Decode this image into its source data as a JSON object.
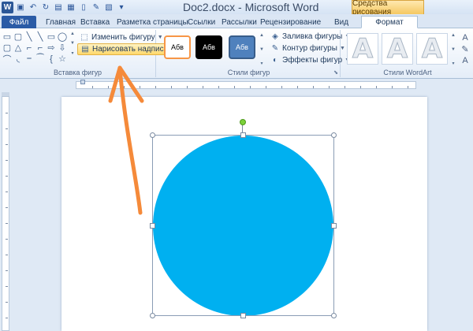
{
  "window": {
    "title": "Doc2.docx - Microsoft Word",
    "context_tab_group": "Средства рисования",
    "word_logo": "W"
  },
  "quick_access": [
    "save-icon",
    "undo-icon",
    "redo-icon",
    "open-icon",
    "print-icon",
    "new-icon",
    "format-painter-icon",
    "image-icon",
    "customize-icon"
  ],
  "tabs": [
    {
      "label": "Файл",
      "type": "file"
    },
    {
      "label": "Главная"
    },
    {
      "label": "Вставка"
    },
    {
      "label": "Разметка страницы"
    },
    {
      "label": "Ссылки"
    },
    {
      "label": "Рассылки"
    },
    {
      "label": "Рецензирование"
    },
    {
      "label": "Вид"
    },
    {
      "label": "Формат",
      "active": true
    }
  ],
  "ribbon": {
    "insert_shapes": {
      "label": "Вставка фигур",
      "edit_shape": "Изменить фигуру",
      "draw_textbox": "Нарисовать надпись",
      "shape_glyphs": [
        "▭",
        "▢",
        "╲",
        "╲",
        "▭",
        "◯",
        "▢",
        "△",
        "⌐",
        "⌐",
        "⇨",
        "⇩",
        "⌒",
        "◟",
        "⎯",
        "⁀",
        "{",
        "☆"
      ]
    },
    "shape_styles": {
      "label": "Стили фигур",
      "thumb_text": "Абв",
      "fill": "Заливка фигуры",
      "outline": "Контур фигуры",
      "effects": "Эффекты фигур",
      "thumb_colors": [
        "#ffffff",
        "#000000",
        "#4f81bd"
      ],
      "thumb_border_colors": [
        "#f79646",
        "#000000",
        "#385d8a"
      ]
    },
    "wordart": {
      "label": "Стили WordArt",
      "letter": "A"
    }
  },
  "document": {
    "shape": {
      "type": "circle",
      "fill": "#00b0f0",
      "selected": true
    }
  },
  "annotation": {
    "type": "arrow",
    "color": "#f58a3a"
  }
}
